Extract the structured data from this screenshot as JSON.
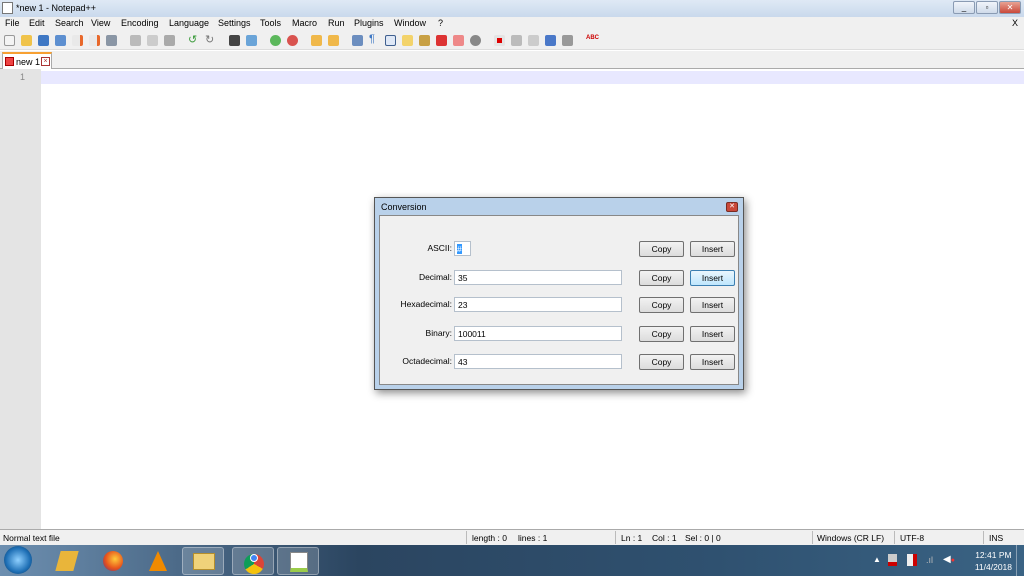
{
  "window": {
    "title": "*new 1 - Notepad++"
  },
  "menu": [
    "File",
    "Edit",
    "Search",
    "View",
    "Encoding",
    "Language",
    "Settings",
    "Tools",
    "Macro",
    "Run",
    "Plugins",
    "Window",
    "?"
  ],
  "menu_close": "X",
  "tab": {
    "label": "new 1"
  },
  "editor": {
    "line_number": "1"
  },
  "dialog": {
    "title": "Conversion",
    "rows": [
      {
        "label": "ASCII:",
        "value": "#",
        "copy": "Copy",
        "insert": "Insert"
      },
      {
        "label": "Decimal:",
        "value": "35",
        "copy": "Copy",
        "insert": "Insert"
      },
      {
        "label": "Hexadecimal:",
        "value": "23",
        "copy": "Copy",
        "insert": "Insert"
      },
      {
        "label": "Binary:",
        "value": "100011",
        "copy": "Copy",
        "insert": "Insert"
      },
      {
        "label": "Octadecimal:",
        "value": "43",
        "copy": "Copy",
        "insert": "Insert"
      }
    ]
  },
  "status": {
    "type": "Normal text file",
    "length": "length : 0",
    "lines": "lines : 1",
    "ln": "Ln : 1",
    "col": "Col : 1",
    "sel": "Sel : 0 | 0",
    "eol": "Windows (CR LF)",
    "encoding": "UTF-8",
    "mode": "INS"
  },
  "taskbar": {
    "time": "12:41 PM",
    "date": "11/4/2018"
  }
}
